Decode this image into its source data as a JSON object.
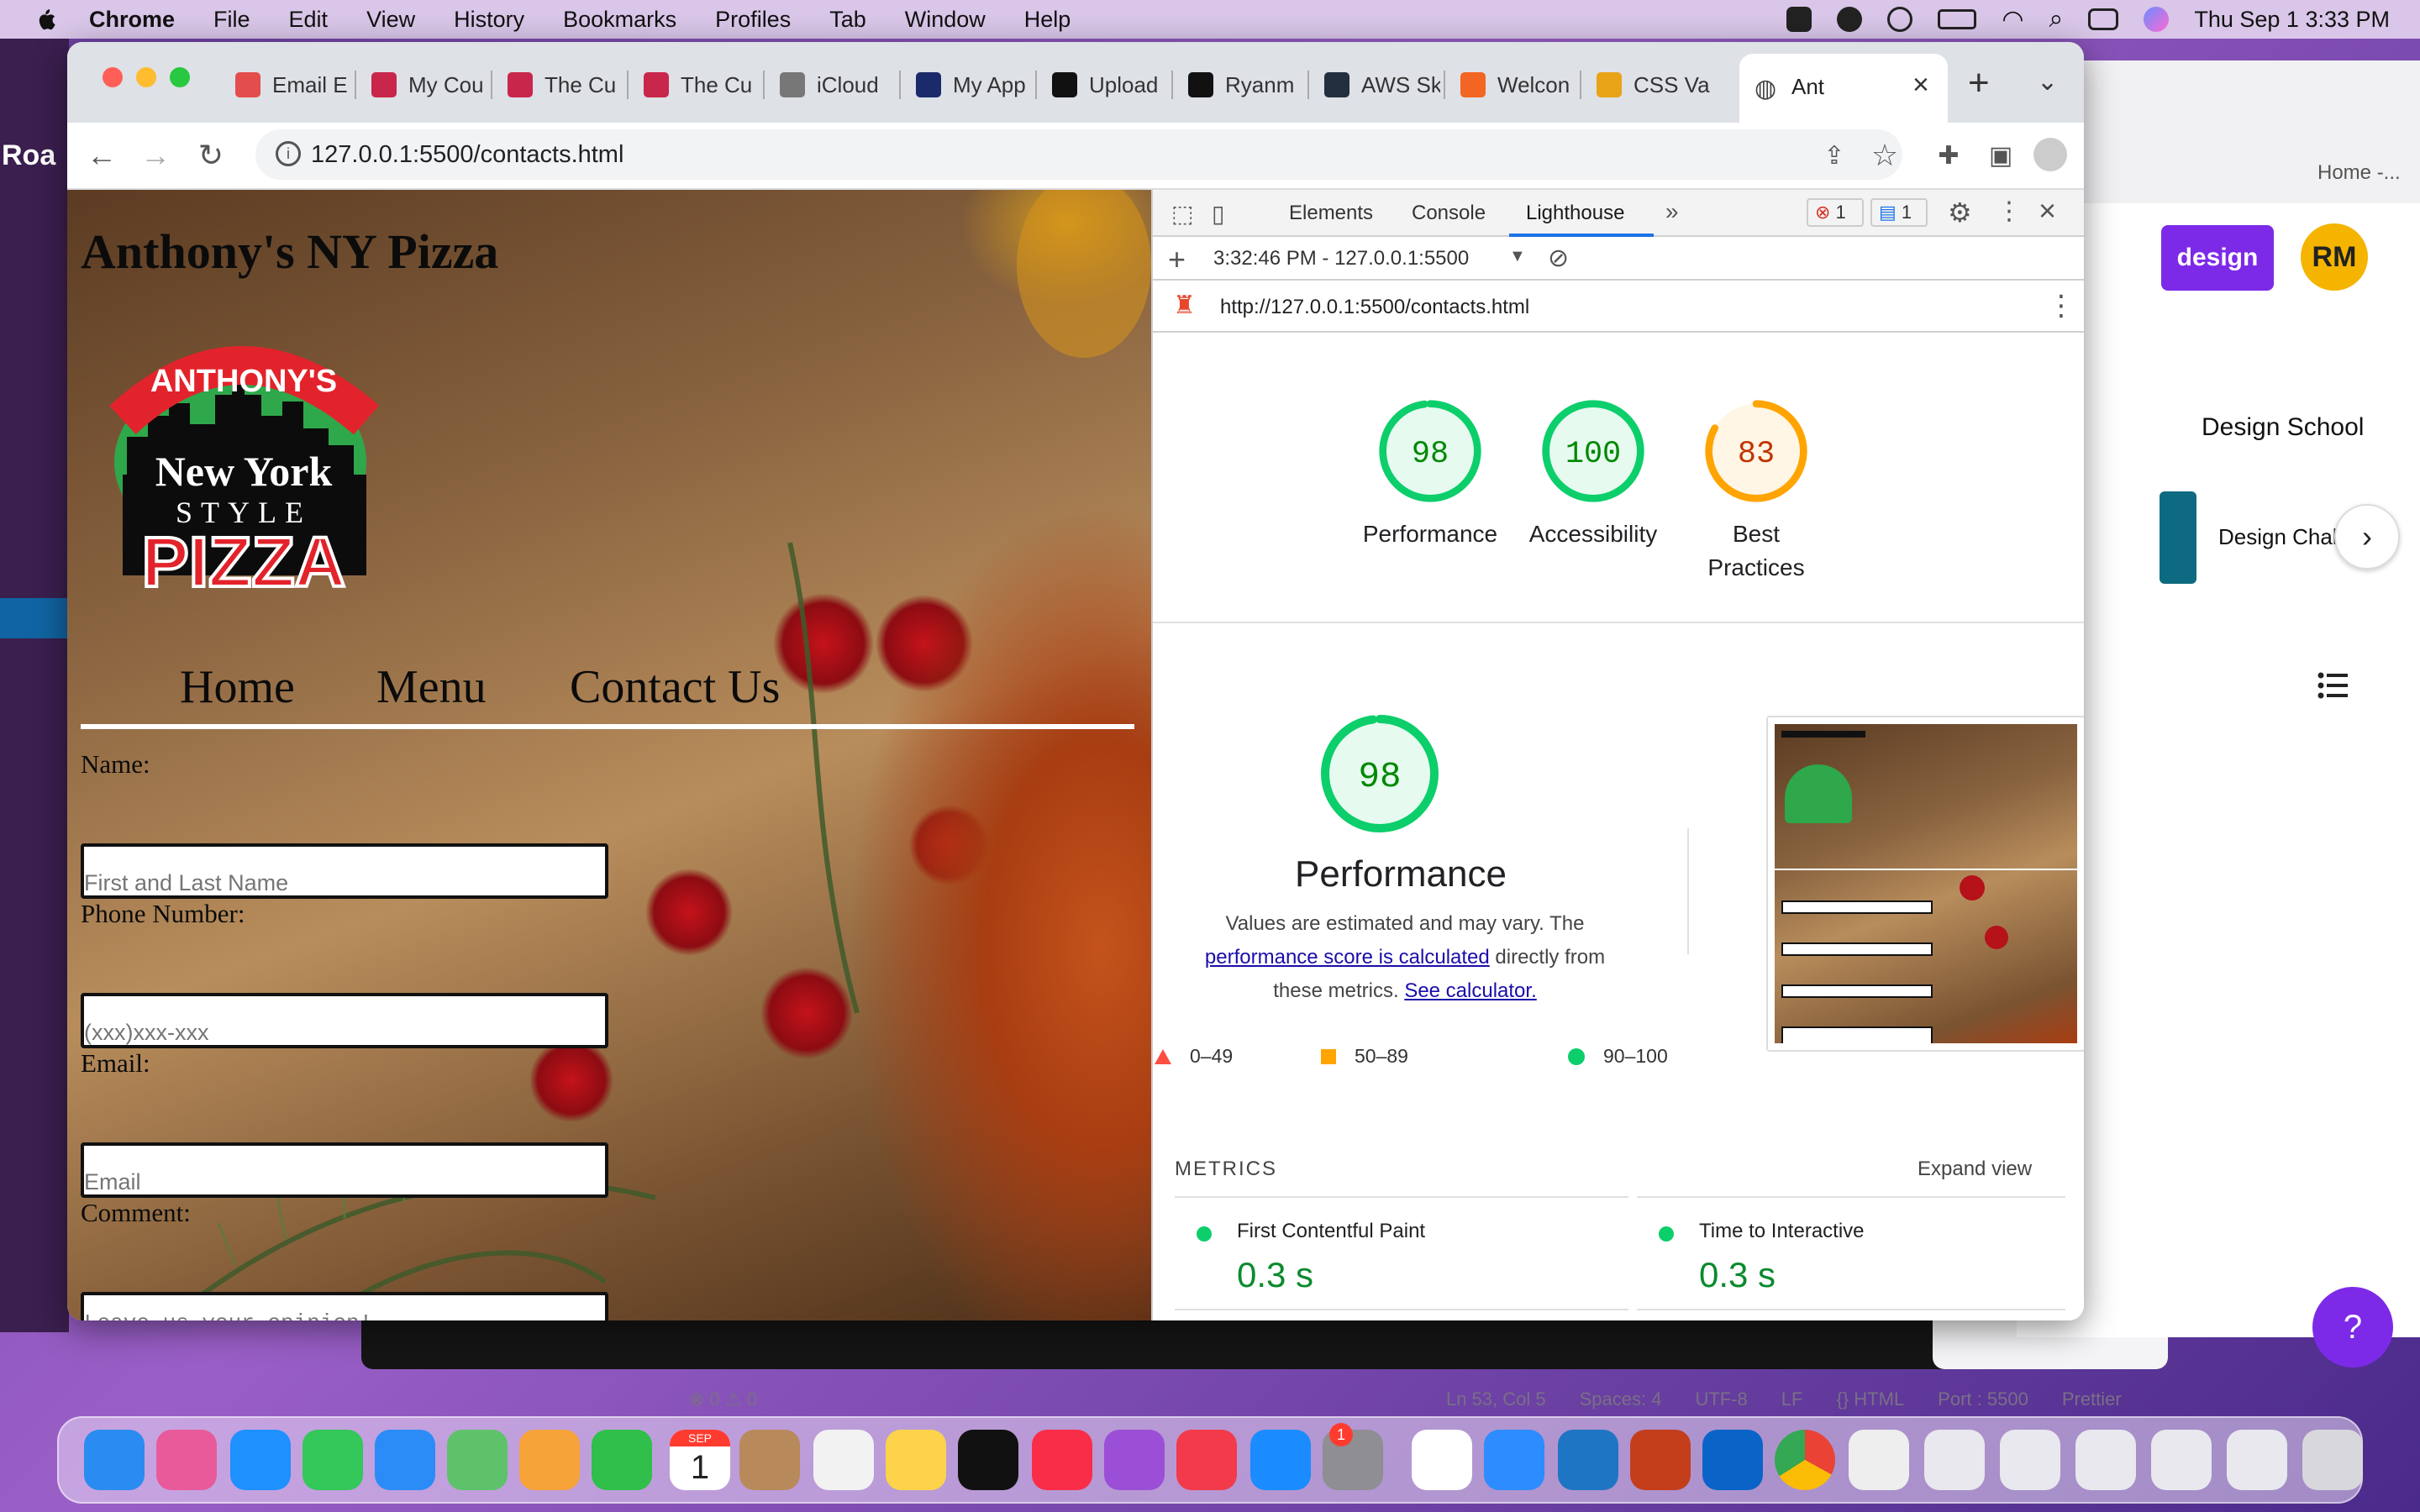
{
  "menubar": {
    "app": "Chrome",
    "items": [
      "File",
      "Edit",
      "View",
      "History",
      "Bookmarks",
      "Profiles",
      "Tab",
      "Window",
      "Help"
    ],
    "datetime": "Thu Sep 1  3:33 PM"
  },
  "background": {
    "canva_design_button": "design",
    "canva_avatar": "RM",
    "canva_tab_label": "Home -...",
    "canva_school": "Design School",
    "canva_card": "Design Chal",
    "canva_help": "?",
    "vscode_status": [
      "Ln 53, Col 5",
      "Spaces: 4",
      "UTF-8",
      "LF",
      "{} HTML",
      "Port : 5500",
      "Prettier"
    ],
    "vscode_errors": "⊗ 0 ⚠ 0",
    "slack_workspace": "Roa"
  },
  "chrome": {
    "tabs": [
      {
        "title": "Email E",
        "color": "#e44d4d"
      },
      {
        "title": "My Cou",
        "color": "#c9264b"
      },
      {
        "title": "The Cu",
        "color": "#c9264b"
      },
      {
        "title": "The Cu",
        "color": "#c9264b"
      },
      {
        "title": "iCloud",
        "color": "#777777"
      },
      {
        "title": "My App",
        "color": "#1b2a6b"
      },
      {
        "title": "Upload",
        "color": "#111111"
      },
      {
        "title": "Ryanm",
        "color": "#111111"
      },
      {
        "title": "AWS Sk",
        "color": "#232f3e"
      },
      {
        "title": "Welcon",
        "color": "#f26522"
      },
      {
        "title": "CSS Va",
        "color": "#e8a317"
      }
    ],
    "active_tab": "Ant",
    "address": "127.0.0.1:5500/contacts.html"
  },
  "site": {
    "title": "Anthony's NY Pizza",
    "logo_text": {
      "top": "ANTHONY'S",
      "mid1": "New York",
      "mid2": "STYLE",
      "bottom": "PIZZA"
    },
    "nav": [
      "Home",
      "Menu",
      "Contact Us"
    ],
    "form": {
      "name_label": "Name:",
      "name_placeholder": "First and Last Name",
      "phone_label": "Phone Number:",
      "phone_placeholder": "(xxx)xxx-xxx",
      "email_label": "Email:",
      "email_placeholder": "Email",
      "comment_label": "Comment:",
      "comment_placeholder": "Leave us your opinion!"
    }
  },
  "devtools": {
    "tabs": [
      "Elements",
      "Console",
      "Lighthouse"
    ],
    "active_tab": "Lighthouse",
    "error_count": "1",
    "message_count": "1",
    "report_time": "3:32:46 PM - 127.0.0.1:5500",
    "report_url": "http://127.0.0.1:5500/contacts.html",
    "scores": [
      {
        "label": "Performance",
        "value": "98",
        "fraction": 0.98,
        "color": "#0cce6b",
        "text": "#008800"
      },
      {
        "label": "Accessibility",
        "value": "100",
        "fraction": 1.0,
        "color": "#0cce6b",
        "text": "#008800"
      },
      {
        "label": "Best Practices",
        "value": "83",
        "fraction": 0.83,
        "color": "#ffa400",
        "text": "#c33300"
      }
    ],
    "performance": {
      "score": "98",
      "score_fraction": 0.98,
      "title": "Performance",
      "desc_1": "Values are estimated and may vary. The",
      "link_1": "performance score is calculated",
      "desc_2": "directly from",
      "desc_3": "these metrics.",
      "link_2": "See calculator."
    },
    "legend": [
      {
        "range": "0–49",
        "color": "#ff4e42"
      },
      {
        "range": "50–89",
        "color": "#ffa400"
      },
      {
        "range": "90–100",
        "color": "#0cce6b"
      }
    ],
    "metrics_label": "METRICS",
    "expand_view": "Expand view",
    "metrics": [
      {
        "name": "First Contentful Paint",
        "value": "0.3 s"
      },
      {
        "name": "Time to Interactive",
        "value": "0.3 s"
      }
    ]
  },
  "dock": {
    "calendar_month": "SEP",
    "calendar_day": "1",
    "settings_badge": "1"
  }
}
